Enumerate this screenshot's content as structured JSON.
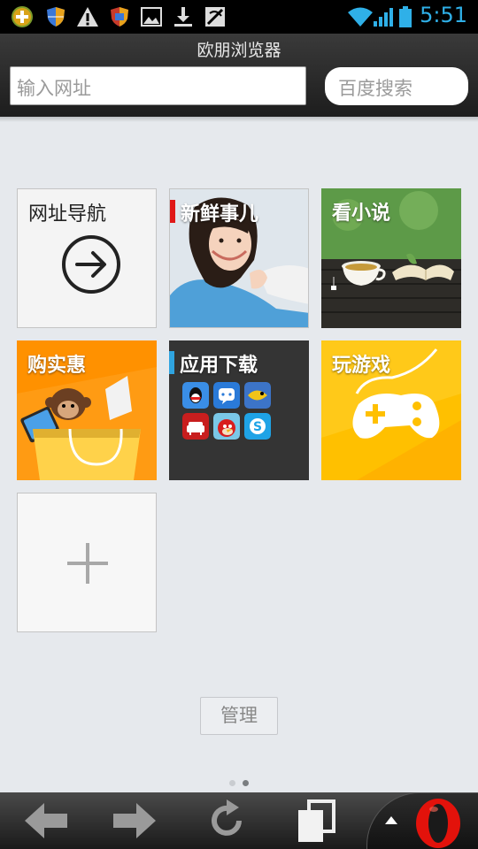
{
  "status_bar": {
    "time": "5:51",
    "icons": [
      "add-icon",
      "shield-icon",
      "warning-icon",
      "shield-icon",
      "image-icon",
      "download-icon",
      "no-signal-icon",
      "wifi-icon",
      "signal-icon",
      "battery-icon"
    ]
  },
  "header": {
    "title": "欧朋浏览器",
    "url_placeholder": "输入网址",
    "search_placeholder": "百度搜索"
  },
  "tiles": [
    {
      "label": "网址导航",
      "icon": "arrow-circle-icon"
    },
    {
      "label": "新鲜事儿",
      "accent": "#e01818"
    },
    {
      "label": "看小说"
    },
    {
      "label": "购实惠"
    },
    {
      "label": "应用下载",
      "accent": "#2fa4e0",
      "apps": [
        "qq-icon",
        "chat-icon",
        "fish-icon",
        "sofa-icon",
        "angry-bird-icon",
        "skype-icon"
      ]
    },
    {
      "label": "玩游戏",
      "icon": "gamepad-icon"
    },
    {
      "icon": "plus-icon"
    }
  ],
  "manage_label": "管理",
  "page_indicator": {
    "count": 2,
    "active": 2
  },
  "colors": {
    "time": "#2fb0e8",
    "shop_tile": "#ff8a00",
    "game_tile": "#ffc000",
    "apps_tile": "#343434",
    "opera_red": "#e3120b"
  }
}
